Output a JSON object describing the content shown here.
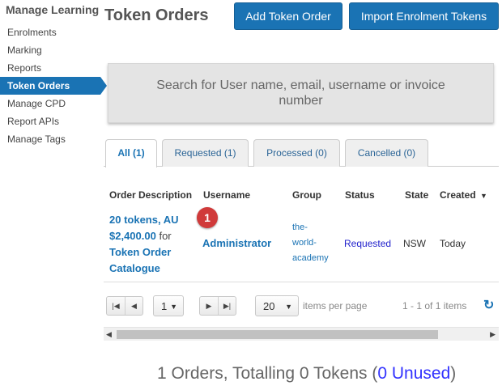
{
  "sidebar": {
    "title": "Manage Learning",
    "items": [
      {
        "label": "Enrolments"
      },
      {
        "label": "Marking"
      },
      {
        "label": "Reports"
      },
      {
        "label": "Token Orders",
        "active": true
      },
      {
        "label": "Manage CPD"
      },
      {
        "label": "Report APIs"
      },
      {
        "label": "Manage Tags"
      }
    ]
  },
  "header": {
    "title": "Token Orders",
    "add_button": "Add Token Order",
    "import_button": "Import Enrolment Tokens"
  },
  "search": {
    "placeholder": "Search for User name, email, username or invoice number"
  },
  "tabs": [
    {
      "label": "All (1)",
      "active": true
    },
    {
      "label": "Requested (1)"
    },
    {
      "label": "Processed (0)"
    },
    {
      "label": "Cancelled (0)"
    }
  ],
  "table": {
    "columns": [
      "Order Description",
      "Username",
      "Group",
      "Status",
      "State",
      "Created"
    ],
    "sort_indicator": "▼",
    "rows": [
      {
        "description_link": "20 tokens, AU $2,400.00",
        "description_for": "for",
        "catalogue_link": "Token Order Catalogue",
        "username": "Administrator",
        "group_lines": [
          "the-",
          "world-",
          "academy"
        ],
        "status": "Requested",
        "state": "NSW",
        "created": "Today"
      }
    ]
  },
  "marker": {
    "label": "1",
    "color": "#d03a3a"
  },
  "pager": {
    "page": "1",
    "page_size": "20",
    "items_per_page": "items per page",
    "range_info": "1 - 1 of 1 items"
  },
  "summary": {
    "text": "1 Orders, Totalling 0 Tokens (",
    "unused": "0 Unused",
    "close": ")"
  },
  "colors": {
    "accent": "#1a73b4",
    "status": "#2222cc"
  }
}
